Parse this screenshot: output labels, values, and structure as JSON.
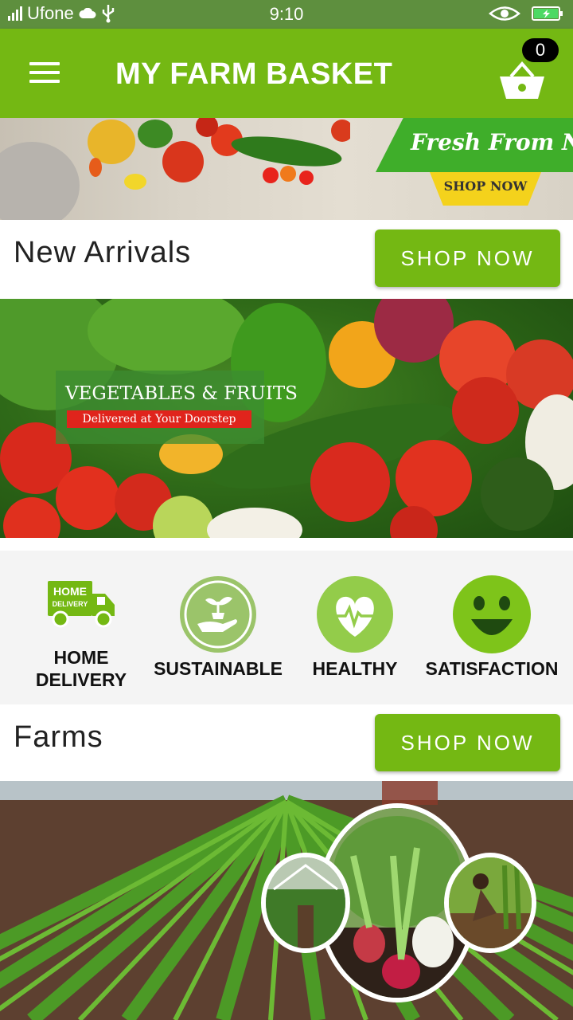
{
  "status_bar": {
    "carrier": "Ufone",
    "time": "9:10"
  },
  "app_bar": {
    "title": "MY FARM BASKET",
    "cart_count": "0"
  },
  "hero_banner": {
    "headline": "Fresh From Nature",
    "tag": "SHOP NOW"
  },
  "new_arrivals": {
    "title": "New Arrivals",
    "button_label": "SHOP NOW"
  },
  "veg_banner": {
    "title": "VEGETABLES & FRUITS",
    "subtitle": "Delivered at Your Doorstep"
  },
  "features": [
    {
      "icon": "delivery-truck-icon",
      "truck_text_1": "HOME",
      "truck_text_2": "DELIVERY",
      "label_1": "HOME",
      "label_2": "DELIVERY"
    },
    {
      "icon": "plant-in-hand-icon",
      "label": "SUSTAINABLE"
    },
    {
      "icon": "heart-pulse-icon",
      "label": "HEALTHY"
    },
    {
      "icon": "smiley-face-icon",
      "label": "SATISFACTION"
    }
  ],
  "farms": {
    "title": "Farms",
    "button_label": "SHOP NOW"
  },
  "colors": {
    "primary_green": "#74b813",
    "status_bar": "#5e8f3e"
  }
}
